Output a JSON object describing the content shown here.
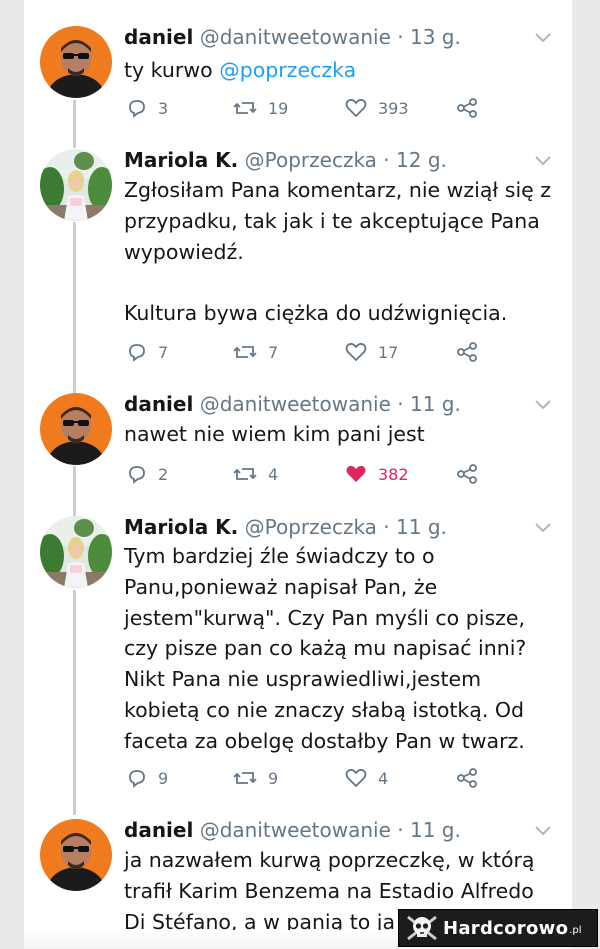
{
  "tweets": [
    {
      "name": "daniel",
      "handle": "@danitweetowanie",
      "time": "· 13 g.",
      "text": "ty kurwo ",
      "mention": "@poprzeczka",
      "replies": "3",
      "retweets": "19",
      "likes": "393",
      "liked": false,
      "avatar": "man-avatar"
    },
    {
      "name": "Mariola K.",
      "handle": "@Poprzeczka",
      "time": "· 12 g.",
      "text": "Zgłosiłam Pana komentarz, nie wziął się z przypadku, tak jak i te akceptujące Pana wypowiedź.\n\nKultura bywa ciężka do udźwignięcia.",
      "replies": "7",
      "retweets": "7",
      "likes": "17",
      "liked": false,
      "avatar": "woman-avatar"
    },
    {
      "name": "daniel",
      "handle": "@danitweetowanie",
      "time": "· 11 g.",
      "text": "nawet nie wiem kim pani jest",
      "replies": "2",
      "retweets": "4",
      "likes": "382",
      "liked": true,
      "avatar": "man-avatar"
    },
    {
      "name": "Mariola K.",
      "handle": "@Poprzeczka",
      "time": "· 11 g.",
      "text": "Tym bardziej źle świadczy to o Panu,ponieważ napisał Pan, że jestem\"kurwą\". Czy Pan myśli co pisze, czy pisze pan co każą mu napisać inni? Nikt Pana nie usprawiedliwi,jestem kobietą co nie znaczy słabą istotką. Od faceta za obelgę dostałby Pan w twarz.",
      "replies": "9",
      "retweets": "9",
      "likes": "4",
      "liked": false,
      "avatar": "woman-avatar"
    },
    {
      "name": "daniel",
      "handle": "@danitweetowanie",
      "time": "· 11 g.",
      "text": "ja nazwałem kurwą poprzeczkę, w którą trafił Karim Benzema na Estadio Alfredo Di Stéfano, a w panią to ja n",
      "avatar": "man-avatar"
    }
  ],
  "watermark": {
    "text": "Hardcorowo",
    "tld": ".pl",
    "icon": "skull-logo-icon"
  },
  "colors": {
    "link": "#1da1f2",
    "secondary": "#657786",
    "like": "#e0245e",
    "thread": "#c8ced3"
  }
}
